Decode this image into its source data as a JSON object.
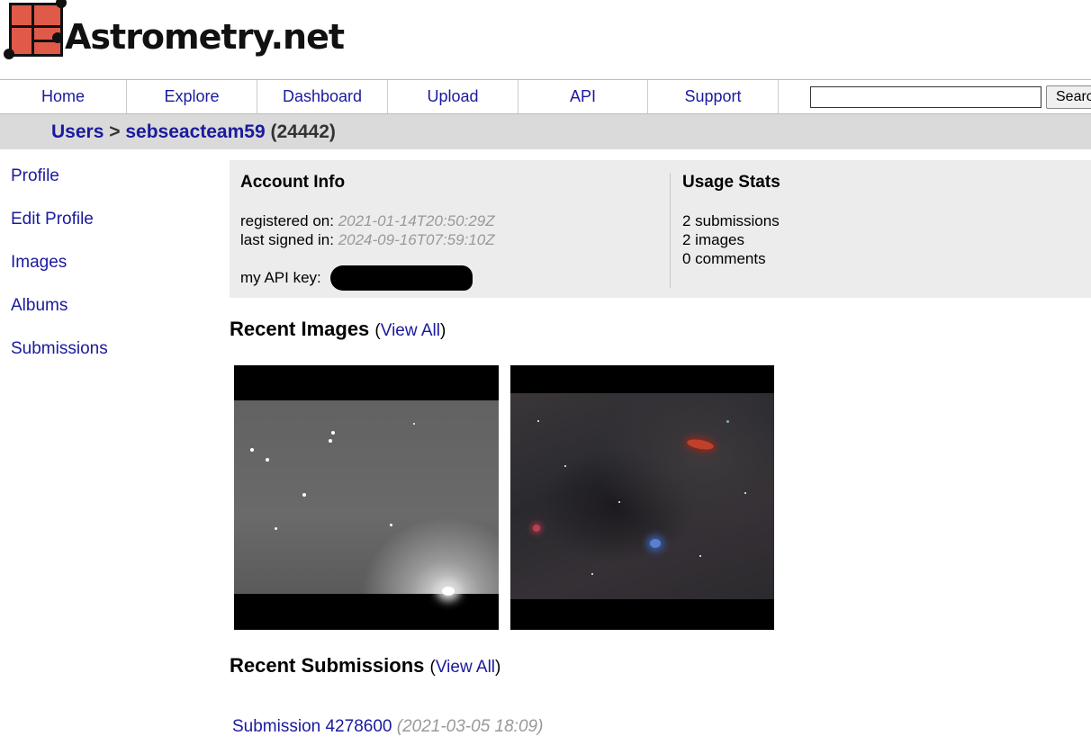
{
  "brand": {
    "name": "Astrometry.net"
  },
  "nav": {
    "items": [
      "Home",
      "Explore",
      "Dashboard",
      "Upload",
      "API",
      "Support"
    ],
    "search_value": "",
    "search_button": "Searc"
  },
  "breadcrumb": {
    "root": "Users",
    "separator": ">",
    "user": "sebseacteam59",
    "id": "(24442)"
  },
  "sidebar": {
    "items": [
      "Profile",
      "Edit Profile",
      "Images",
      "Albums",
      "Submissions"
    ]
  },
  "account": {
    "heading": "Account Info",
    "registered_label": "registered on:",
    "registered_value": "2021-01-14T20:50:29Z",
    "signed_label": "last signed in:",
    "signed_value": "2024-09-16T07:59:10Z",
    "api_label": "my API key:"
  },
  "usage": {
    "heading": "Usage Stats",
    "lines": [
      "2 submissions",
      "2 images",
      "0 comments"
    ]
  },
  "recent_images": {
    "title": "Recent Images",
    "view_all": "View All"
  },
  "recent_submissions": {
    "title": "Recent Submissions",
    "view_all": "View All",
    "items": [
      {
        "label": "Submission 4278600",
        "date": "(2021-03-05 18:09)"
      }
    ]
  },
  "colors": {
    "link": "#1a1a9e",
    "breadcrumb_bg": "#dadada",
    "panel_bg": "#ececec",
    "logo_red": "#e05a4a"
  }
}
